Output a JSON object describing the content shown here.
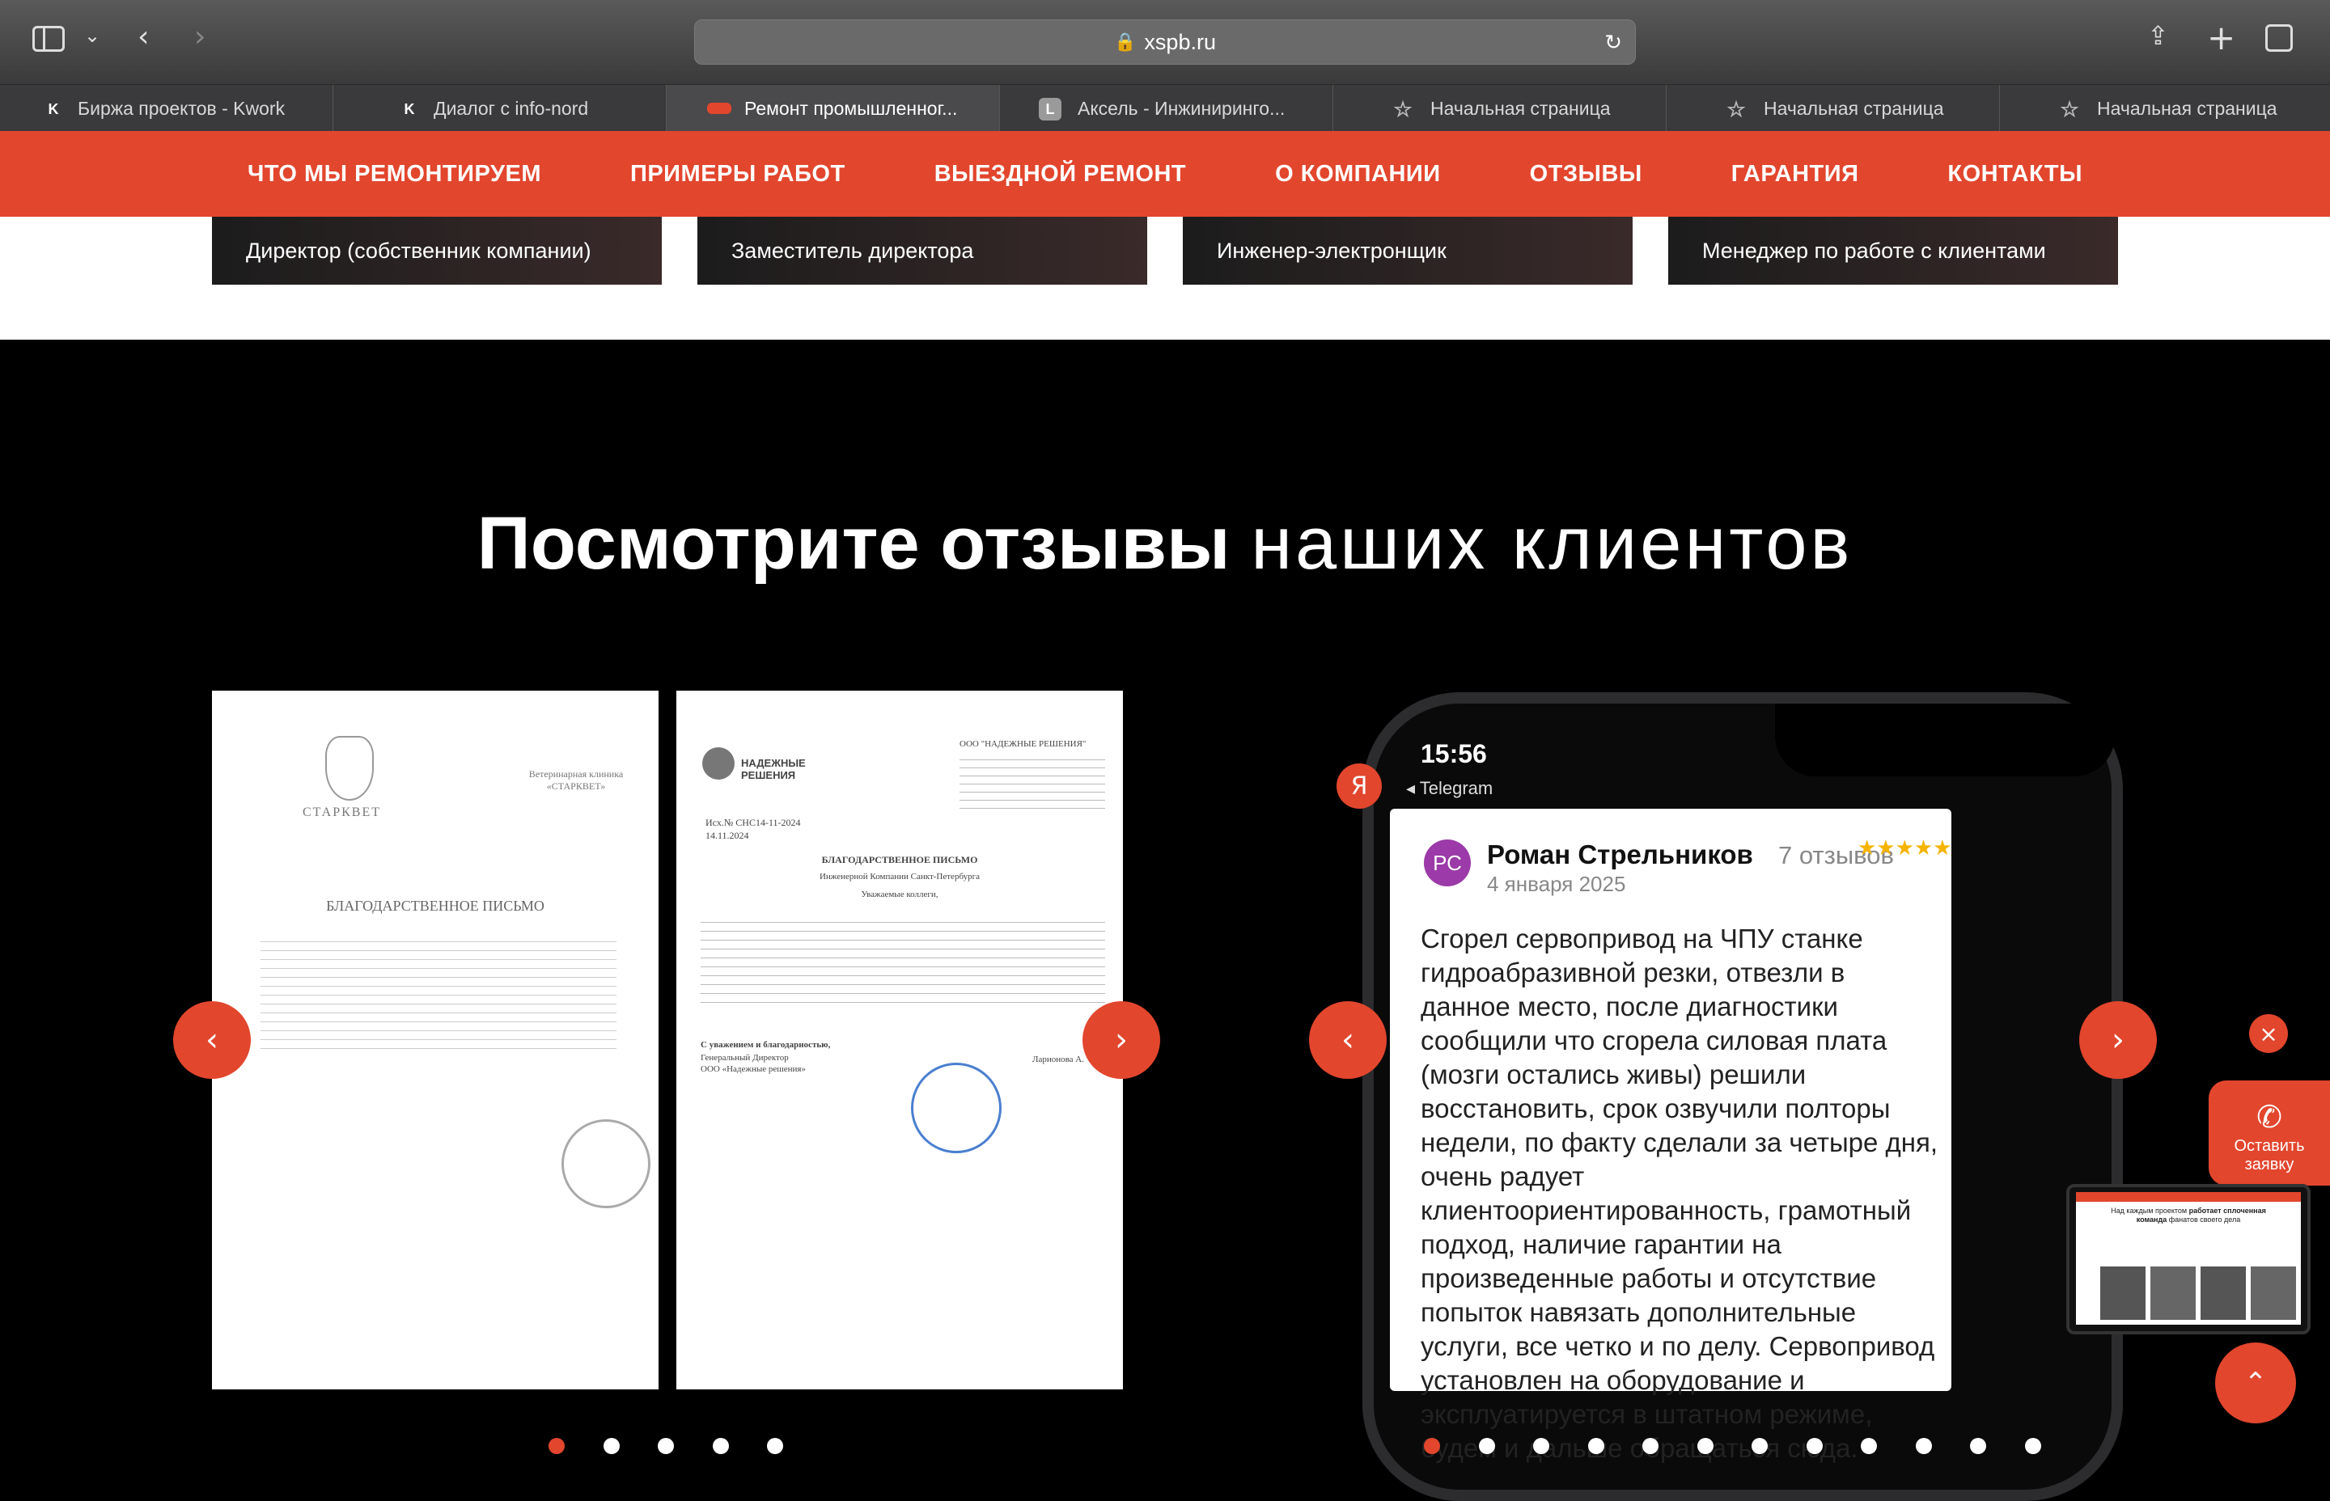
{
  "browser": {
    "url": "xspb.ru",
    "tabs": [
      {
        "label": "Биржа проектов - Kwork",
        "icon": "kwork-icon"
      },
      {
        "label": "Диалог с info-nord",
        "icon": "kwork-icon"
      },
      {
        "label": "Ремонт промышленног...",
        "icon": "site-logo-icon"
      },
      {
        "label": "Аксель - Инжиниринго...",
        "icon": "letter-l-icon"
      },
      {
        "label": "Начальная страница",
        "icon": "star-icon"
      },
      {
        "label": "Начальная страница",
        "icon": "star-icon"
      },
      {
        "label": "Начальная страница",
        "icon": "star-icon"
      }
    ]
  },
  "nav": {
    "items": [
      "ЧТО МЫ РЕМОНТИРУЕМ",
      "ПРИМЕРЫ РАБОТ",
      "ВЫЕЗДНОЙ РЕМОНТ",
      "О КОМПАНИИ",
      "ОТЗЫВЫ",
      "ГАРАНТИЯ",
      "КОНТАКТЫ"
    ]
  },
  "team": {
    "roles": [
      "Директор (собственник компании)",
      "Заместитель директора",
      "Инженер-электронщик",
      "Менеджер по работе с клиентами"
    ]
  },
  "reviews": {
    "title_bold": "Посмотрите отзывы",
    "title_light": "наших клиентов",
    "letter1": {
      "logo": "СТАРКВЕТ",
      "org": "Ветеринарная клиника «СТАРКВЕТ»",
      "heading": "БЛАГОДАРСТВЕННОЕ ПИСЬМО"
    },
    "letter2": {
      "logo": "НАДЕЖНЫЕ РЕШЕНИЯ",
      "org": "ООО \"НАДЕЖНЫЕ РЕШЕНИЯ\"",
      "ref": "Исх.№ СНС14-11-2024",
      "date": "14.11.2024",
      "heading": "БЛАГОДАРСТВЕННОЕ ПИСЬМО",
      "addressee": "Инженерной Компании Санкт-Петербурга",
      "greeting": "Уважаемые коллеги,",
      "sign": "С уважением и благодарностью,",
      "sign_role": "Генеральный Директор",
      "sign_org": "ООО «Надежные решения»",
      "signer": "Ларионова А."
    },
    "letters_dots": 5,
    "letters_active_dot": 0,
    "phone": {
      "time": "15:56",
      "back_app": "◂ Telegram",
      "avatar_initials": "РС",
      "author": "Роман Стрельников",
      "review_count": "7 отзывов",
      "date": "4 января 2025",
      "stars": "★★★★★",
      "text": "Сгорел сервопривод на ЧПУ станке гидроабразивной резки, отвезли в данное место, после диагностики сообщили что сгорела силовая плата (мозги остались живы) решили восстановить, срок озвучили полторы недели, по факту сделали за четыре дня, очень радует клиентоориентированность, грамотный подход, наличие гарантии на произведенные работы и отсутствие попыток навязать дополнительные услуги, все четко и по делу. Сервопривод установлен на оборудование и эксплуатируется в штатном режиме, будем и дальше обращаться сюда."
    },
    "phone_dots": 12,
    "phone_active_dot": 0
  },
  "widgets": {
    "callback_label": "Оставить заявку",
    "close_symbol": "×",
    "video_text_prefix": "Над каждым проектом",
    "video_text_bold1": "работает сплоченная команда",
    "video_text_suffix": "фанатов своего дела"
  },
  "colors": {
    "accent": "#e2462d",
    "bg": "#000000"
  }
}
